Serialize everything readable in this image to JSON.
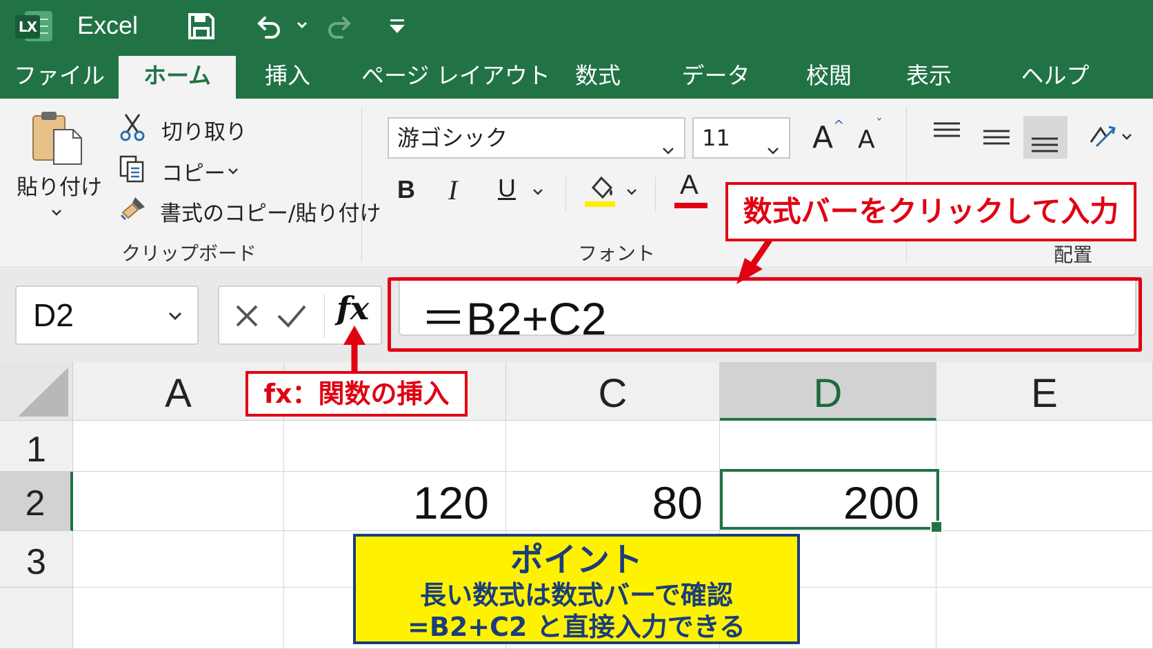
{
  "app": {
    "title": "Excel",
    "logo_text": "LX"
  },
  "quick_access": {
    "save": "save-icon",
    "undo": "undo-icon",
    "redo": "redo-icon",
    "customize": "customize-icon"
  },
  "tabs": [
    {
      "label": "ファイル"
    },
    {
      "label": "ホーム",
      "active": true
    },
    {
      "label": "挿入"
    },
    {
      "label": "ページ レイアウト"
    },
    {
      "label": "数式"
    },
    {
      "label": "データ"
    },
    {
      "label": "校閲"
    },
    {
      "label": "表示"
    },
    {
      "label": "ヘルプ"
    }
  ],
  "clipboard": {
    "paste": "貼り付け",
    "cut": "切り取り",
    "copy": "コピー",
    "format_painter": "書式のコピー/貼り付け",
    "group_label": "クリップボード"
  },
  "font": {
    "name": "游ゴシック",
    "size": "11",
    "grow": "A",
    "shrink": "A",
    "bold": "B",
    "italic": "I",
    "underline": "U",
    "font_color": "A",
    "group_label": "フォント",
    "fill_color": "#ffee00",
    "text_color": "#e00012"
  },
  "alignment": {
    "group_label": "配置"
  },
  "formula_bar": {
    "name_box": "D2",
    "fx_label": "fx",
    "formula": "＝B2+C2"
  },
  "grid": {
    "columns": [
      "A",
      "",
      "C",
      "D",
      "E"
    ],
    "rows": [
      "1",
      "2",
      "3",
      ""
    ],
    "cells": {
      "B2": "120",
      "C2": "80",
      "D2": "200"
    },
    "selected_cell": "D2",
    "accent": "#217346"
  },
  "annotations": {
    "formula_bar_note": "数式バーをクリックして入力",
    "fx_note": "fx：関数の挿入",
    "point_title": "ポイント",
    "point_line1": "長い数式は数式バーで確認",
    "point_line2": "=B2+C2 と直接入力できる",
    "highlight_color": "#e00012"
  }
}
